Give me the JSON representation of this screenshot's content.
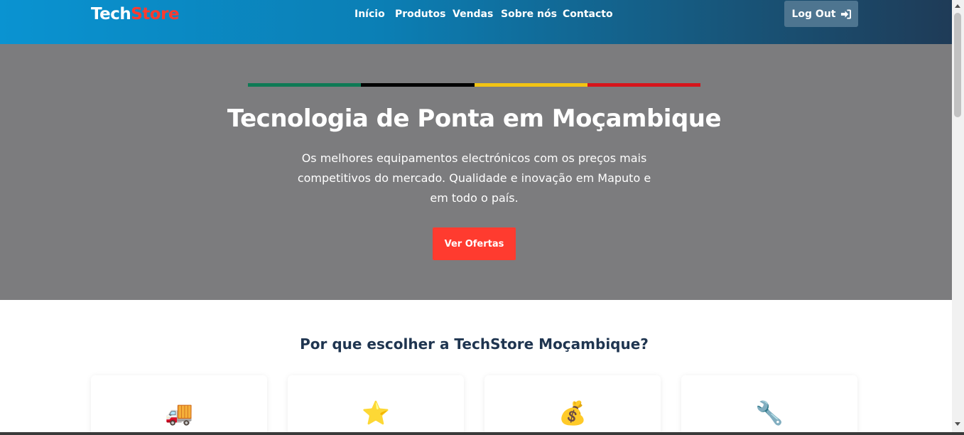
{
  "header": {
    "logo_part1": "Tech",
    "logo_part2": "Store",
    "nav": [
      "Início",
      "Produtos",
      "Vendas",
      "Sobre nós",
      "Contacto"
    ],
    "logout_label": "Log Out",
    "logout_icon": "sign-in-icon"
  },
  "hero": {
    "flag_colors": [
      "#0e7a55",
      "#000000",
      "#f2c313",
      "#d6141b"
    ],
    "title": "Tecnologia de Ponta em Moçambique",
    "subtitle": "Os melhores equipamentos electrónicos com os preços mais competitivos do mercado. Qualidade e inovação em Maputo e em todo o país.",
    "cta_label": "Ver Ofertas"
  },
  "why": {
    "title": "Por que escolher a TechStore Moçambique?",
    "cards": [
      {
        "icon": "delivery-truck-icon",
        "emoji": "🚚"
      },
      {
        "icon": "star-icon",
        "emoji": "⭐"
      },
      {
        "icon": "money-bag-icon",
        "emoji": "💰"
      },
      {
        "icon": "wrench-icon",
        "emoji": "🔧"
      }
    ]
  },
  "colors": {
    "accent": "#ff3b2f",
    "hero_bg": "#7c7c7e",
    "heading": "#1f3550"
  }
}
